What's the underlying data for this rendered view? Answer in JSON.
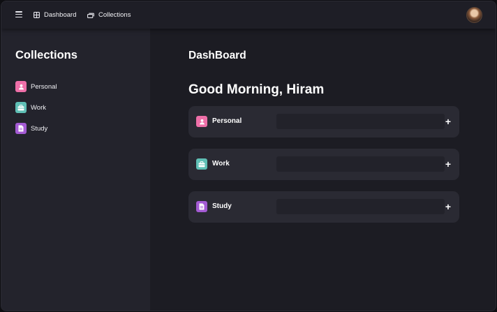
{
  "topbar": {
    "menu_icon": "hamburger-icon",
    "nav": [
      {
        "label": "Dashboard",
        "icon": "grid-icon"
      },
      {
        "label": "Collections",
        "icon": "stack-icon"
      }
    ]
  },
  "sidebar": {
    "title": "Collections",
    "items": [
      {
        "label": "Personal",
        "icon": "person-icon",
        "color": "#ee6fa8"
      },
      {
        "label": "Work",
        "icon": "briefcase-icon",
        "color": "#5fbfb5"
      },
      {
        "label": "Study",
        "icon": "document-icon",
        "color": "#a35ad3"
      }
    ]
  },
  "main": {
    "title": "DashBoard",
    "greeting": "Good Morning, Hiram",
    "cards": [
      {
        "label": "Personal",
        "icon": "person-icon",
        "color": "#ee6fa8",
        "progress": 0,
        "action": "+"
      },
      {
        "label": "Work",
        "icon": "briefcase-icon",
        "color": "#5fbfb5",
        "progress": 0,
        "action": "+"
      },
      {
        "label": "Study",
        "icon": "document-icon",
        "color": "#a35ad3",
        "progress": 0,
        "action": "+"
      }
    ]
  },
  "colors": {
    "background": "#1c1c23",
    "sidebar": "#23232c",
    "card": "#2a2a33",
    "track": "#22222a"
  }
}
